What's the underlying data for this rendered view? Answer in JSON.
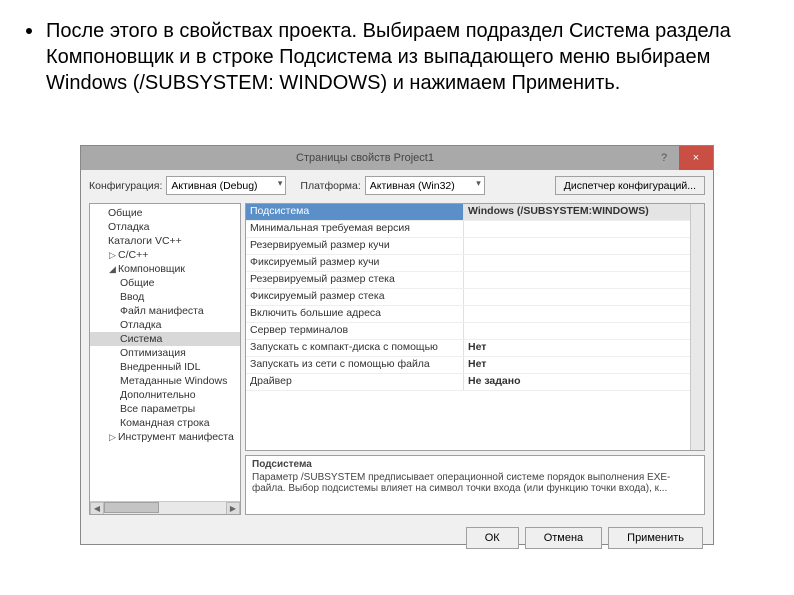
{
  "slide": {
    "text": "После этого в свойствах проекта. Выбираем подраздел Система раздела Компоновщик и в строке Подсистема из выпадающего меню выбираем Windows (/SUBSYSTEM: WINDOWS) и нажимаем Применить."
  },
  "dialog": {
    "title": "Страницы свойств Project1",
    "help": "?",
    "close": "×",
    "toolbar": {
      "config_label": "Конфигурация:",
      "config_value": "Активная (Debug)",
      "platform_label": "Платформа:",
      "platform_value": "Активная (Win32)",
      "manager": "Диспетчер конфигураций..."
    },
    "tree": [
      {
        "label": "Общие",
        "level": 1
      },
      {
        "label": "Отладка",
        "level": 1
      },
      {
        "label": "Каталоги VC++",
        "level": 1
      },
      {
        "label": "C/C++",
        "level": 1,
        "exp": "▷"
      },
      {
        "label": "Компоновщик",
        "level": 1,
        "exp": "◢"
      },
      {
        "label": "Общие",
        "level": 2
      },
      {
        "label": "Ввод",
        "level": 2
      },
      {
        "label": "Файл манифеста",
        "level": 2
      },
      {
        "label": "Отладка",
        "level": 2
      },
      {
        "label": "Система",
        "level": 2,
        "selected": true
      },
      {
        "label": "Оптимизация",
        "level": 2
      },
      {
        "label": "Внедренный IDL",
        "level": 2
      },
      {
        "label": "Метаданные Windows",
        "level": 2
      },
      {
        "label": "Дополнительно",
        "level": 2
      },
      {
        "label": "Все параметры",
        "level": 2
      },
      {
        "label": "Командная строка",
        "level": 2
      },
      {
        "label": "Инструмент манифеста",
        "level": 1,
        "exp": "▷"
      }
    ],
    "grid": {
      "header": {
        "left": "Подсистема",
        "right": "Windows (/SUBSYSTEM:WINDOWS)"
      },
      "rows": [
        {
          "l": "Минимальная требуемая версия",
          "r": ""
        },
        {
          "l": "Резервируемый размер кучи",
          "r": ""
        },
        {
          "l": "Фиксируемый размер кучи",
          "r": ""
        },
        {
          "l": "Резервируемый размер стека",
          "r": ""
        },
        {
          "l": "Фиксируемый размер стека",
          "r": ""
        },
        {
          "l": "Включить большие адреса",
          "r": ""
        },
        {
          "l": "Сервер терминалов",
          "r": ""
        },
        {
          "l": "Запускать с компакт-диска с помощью",
          "r": "Нет"
        },
        {
          "l": "Запускать из сети с помощью файла",
          "r": "Нет"
        },
        {
          "l": "Драйвер",
          "r": "Не задано"
        }
      ]
    },
    "desc": {
      "title": "Подсистема",
      "body": "Параметр /SUBSYSTEM предписывает операционной системе порядок выполнения EXE-файла. Выбор подсистемы влияет на символ точки входа (или функцию точки входа), к..."
    },
    "footer": {
      "ok": "ОК",
      "cancel": "Отмена",
      "apply": "Применить"
    }
  }
}
